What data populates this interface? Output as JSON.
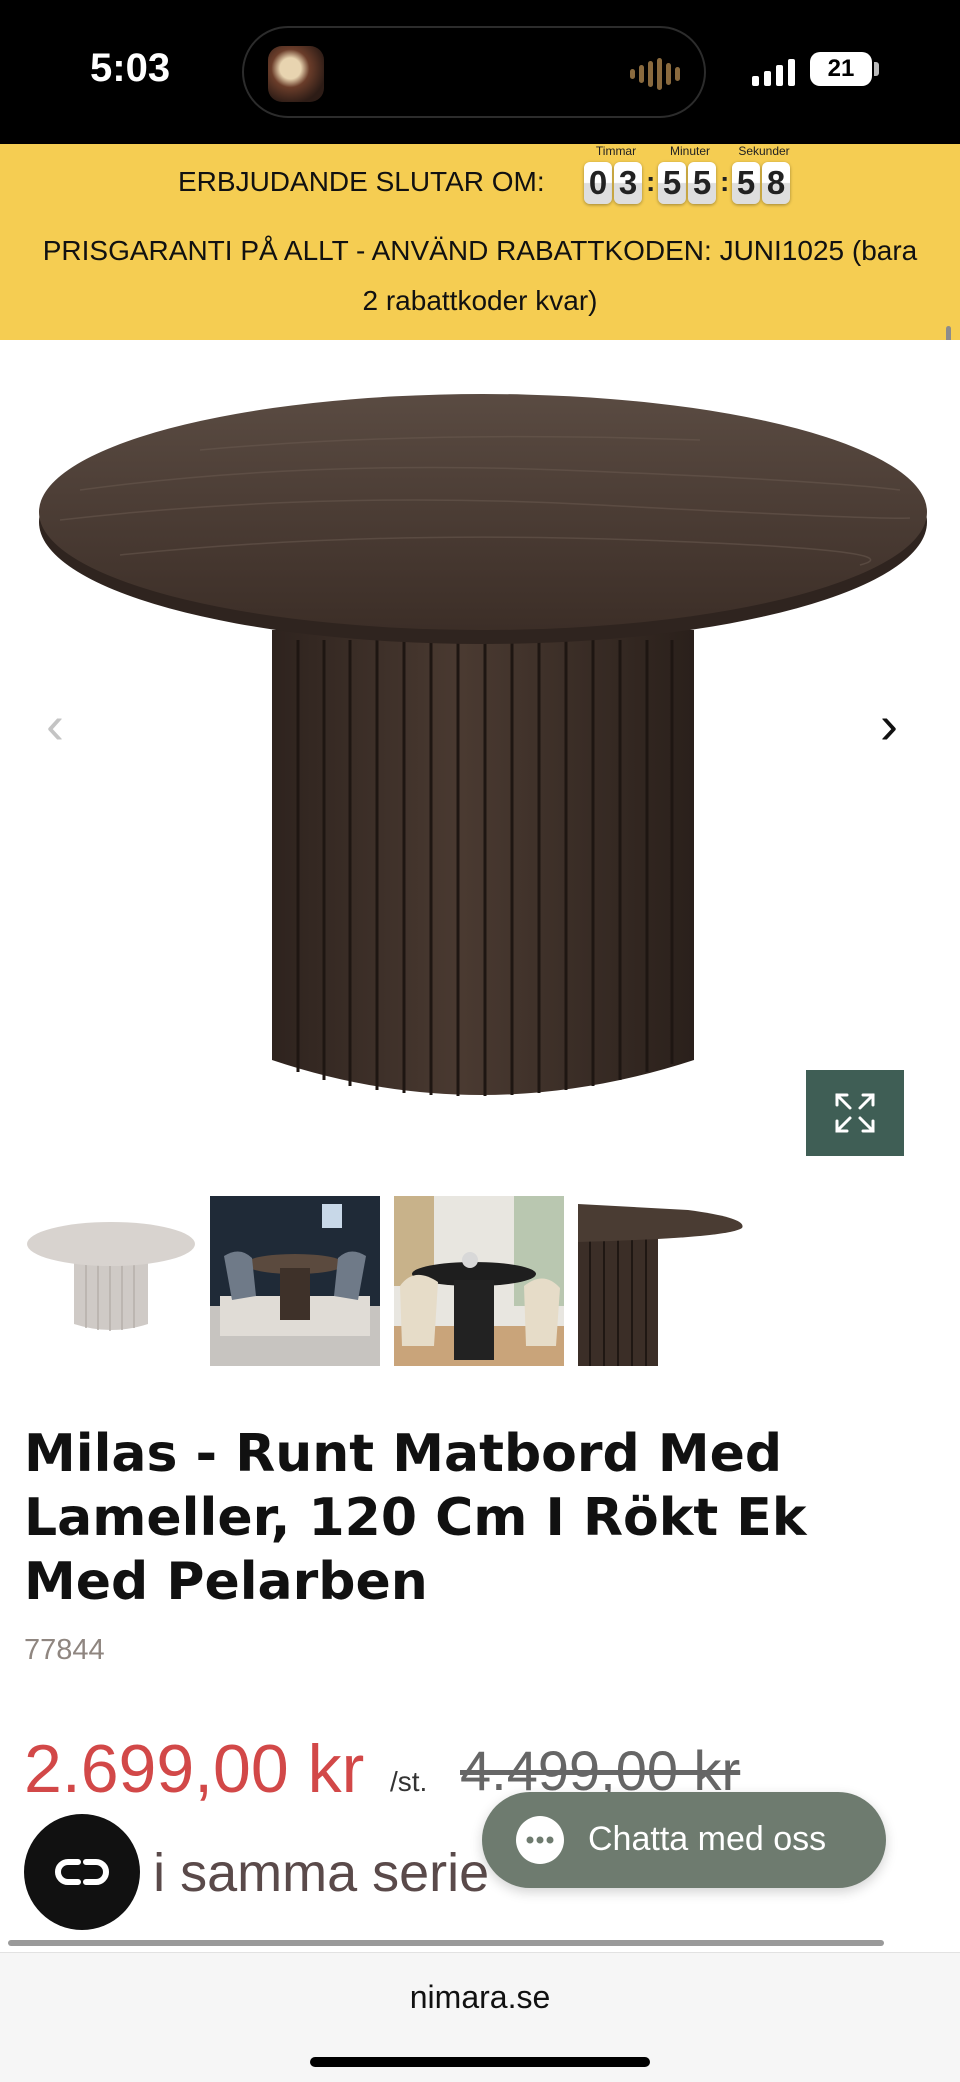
{
  "status_bar": {
    "time": "5:03",
    "battery": "21"
  },
  "promo": {
    "offer_label": "ERBJUDANDE SLUTAR OM:",
    "countdown": {
      "hours_label": "Timmar",
      "minutes_label": "Minuter",
      "seconds_label": "Sekunder",
      "hours": [
        "0",
        "3"
      ],
      "minutes": [
        "5",
        "5"
      ],
      "seconds": [
        "5",
        "8"
      ]
    },
    "guarantee_line1": "PRISGARANTI PÅ ALLT - ANVÄND RABATTKODEN: JUNI1025 (bara",
    "guarantee_line2": "2 rabattkoder kvar)"
  },
  "gallery": {
    "prev_arrow": "‹",
    "next_arrow": "›",
    "expand_icon": "expand-icon"
  },
  "product": {
    "title": "Milas - Runt Matbord Med Lameller, 120 Cm I Rökt Ek Med Pelarben",
    "sku": "77844",
    "price": "2.699,00 kr",
    "unit": "/st.",
    "old_price": "4.499,00 kr",
    "series_heading": "Bord i samma serie"
  },
  "chat": {
    "label": "Chatta med oss"
  },
  "browser": {
    "url": "nimara.se"
  },
  "colors": {
    "promo": "#f5cd52",
    "price": "#d24848",
    "chat": "#6e7b6f",
    "expand": "#3f5e55"
  }
}
